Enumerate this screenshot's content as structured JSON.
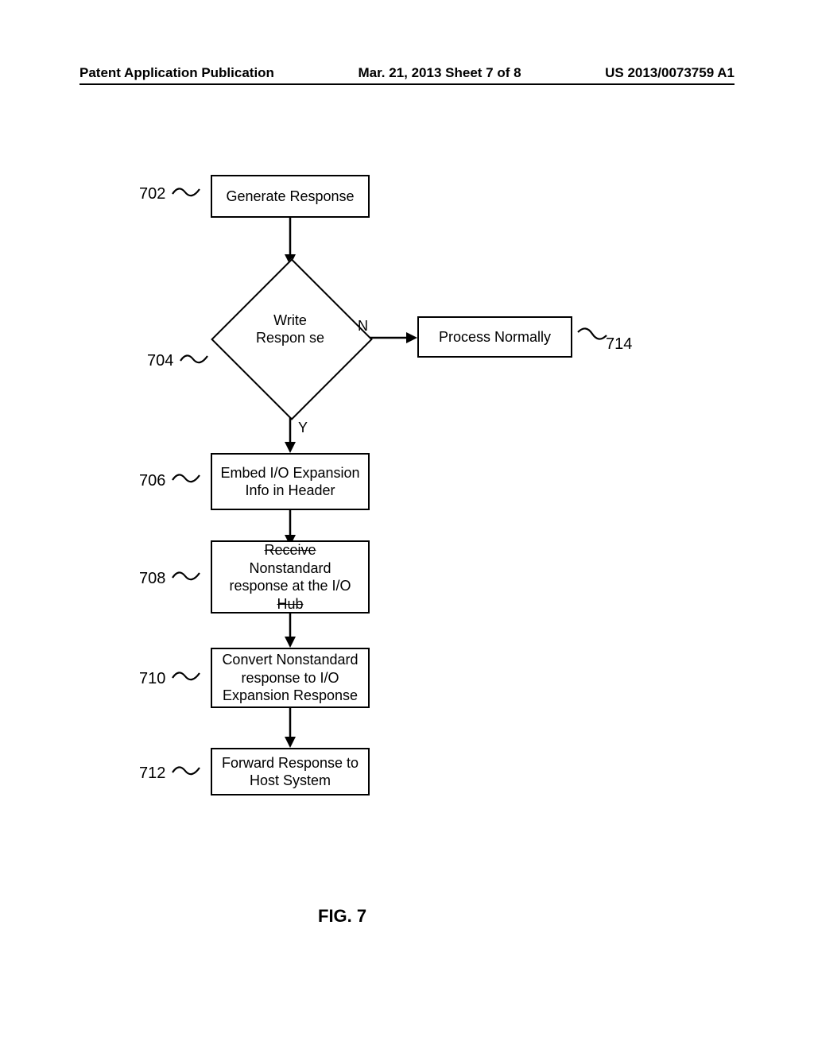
{
  "header": {
    "left": "Patent Application Publication",
    "center": "Mar. 21, 2013  Sheet 7 of 8",
    "right": "US 2013/0073759 A1"
  },
  "refs": {
    "r702": "702",
    "r704": "704",
    "r706": "706",
    "r708": "708",
    "r710": "710",
    "r712": "712",
    "r714": "714"
  },
  "boxes": {
    "b702": "Generate  Response",
    "b706": "Embed I/O Expansion Info in Header",
    "b708": "Receive Nonstandard response at the I/O Hub",
    "b710": "Convert Nonstandard response to I/O Expansion Response",
    "b712": "Forward Response to Host System",
    "b714": "Process Normally"
  },
  "decision": {
    "d704": "Write Respon se"
  },
  "edges": {
    "yes": "Y",
    "no": "N"
  },
  "figure": "FIG. 7"
}
